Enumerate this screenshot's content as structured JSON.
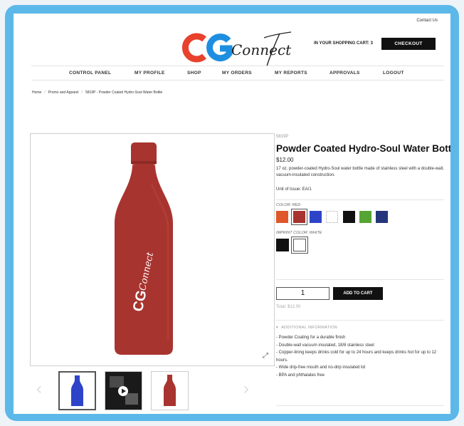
{
  "header": {
    "contact_link": "Contact Us",
    "logo_text": "Connect",
    "cart_text": "IN YOUR SHOPPING CART: 3",
    "checkout_label": "CHECKOUT"
  },
  "nav": {
    "items": [
      "CONTROL PANEL",
      "MY PROFILE",
      "SHOP",
      "MY ORDERS",
      "MY REPORTS",
      "APPROVALS",
      "LOGOUT"
    ]
  },
  "breadcrumb": {
    "items": [
      "Home",
      "Promo and Apparel",
      "5819P - Powder Coated Hydro-Soul Water Bottle"
    ]
  },
  "product": {
    "sku": "5819P",
    "title": "Powder Coated Hydro-Soul Water Bottle",
    "price": "$12.00",
    "description": "17 oz. powder-coated Hydro-Soul water bottle made of stainless steel with a double-wall, vacuum-insulated construction.",
    "unit_of_issue": "Unit of Issue: EA/1",
    "color_label": "COLOR: RED",
    "colors": [
      "#e0572a",
      "#a8342f",
      "#2d44c9",
      "#ffffff",
      "#111111",
      "#55a534",
      "#25367a"
    ],
    "imprint_label": "IMPRINT COLOR: WHITE",
    "imprint_colors": [
      "#111111",
      "#ffffff"
    ],
    "quantity": "1",
    "add_to_cart_label": "ADD TO CART",
    "total": "Total: $12.00",
    "additional_info_label": "ADDITIONAL INFORMATION",
    "features": [
      "- Powder Coating for a durable finish",
      "- Double-wall vacuum insulated, 18/8 stainless steel",
      "- Copper-lining keeps drinks cold for up to 24 hours and keeps drinks hot for up to 12 hours.",
      "- Wide drip-free mouth and no-drip insulated lid",
      "- BPA and phthalates free"
    ]
  },
  "colors": {
    "frame": "#5cb8e8",
    "bottle": "#a8342f",
    "logo_red": "#e8412c",
    "logo_blue": "#1e8fe0"
  }
}
